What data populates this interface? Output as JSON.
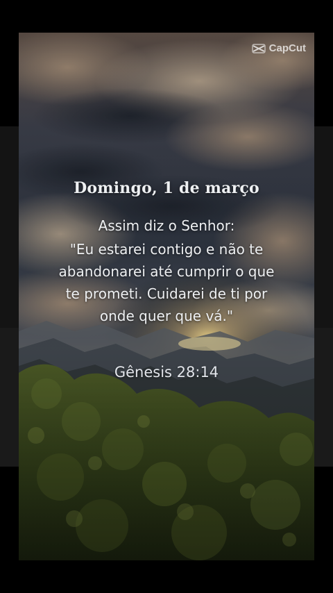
{
  "watermark": {
    "label": "CapCut",
    "icon": "capcut-logo-icon"
  },
  "card": {
    "date": "Domingo, 1 de março",
    "intro": "Assim diz o Senhor:",
    "quote_lines": [
      "\"Eu estarei contigo e não te",
      "abandonarei até cumprir o que",
      "te prometi. Cuidarei de ti por",
      "onde quer que vá.\""
    ],
    "reference": "Gênesis 28:14"
  },
  "colors": {
    "sky_dark": "#2e3440",
    "cloud": "#8a7868",
    "sun_glow": "#f3d98a",
    "mountain": "#3a4048",
    "foliage": "#3d4a1e",
    "text": "#eef0f2"
  }
}
